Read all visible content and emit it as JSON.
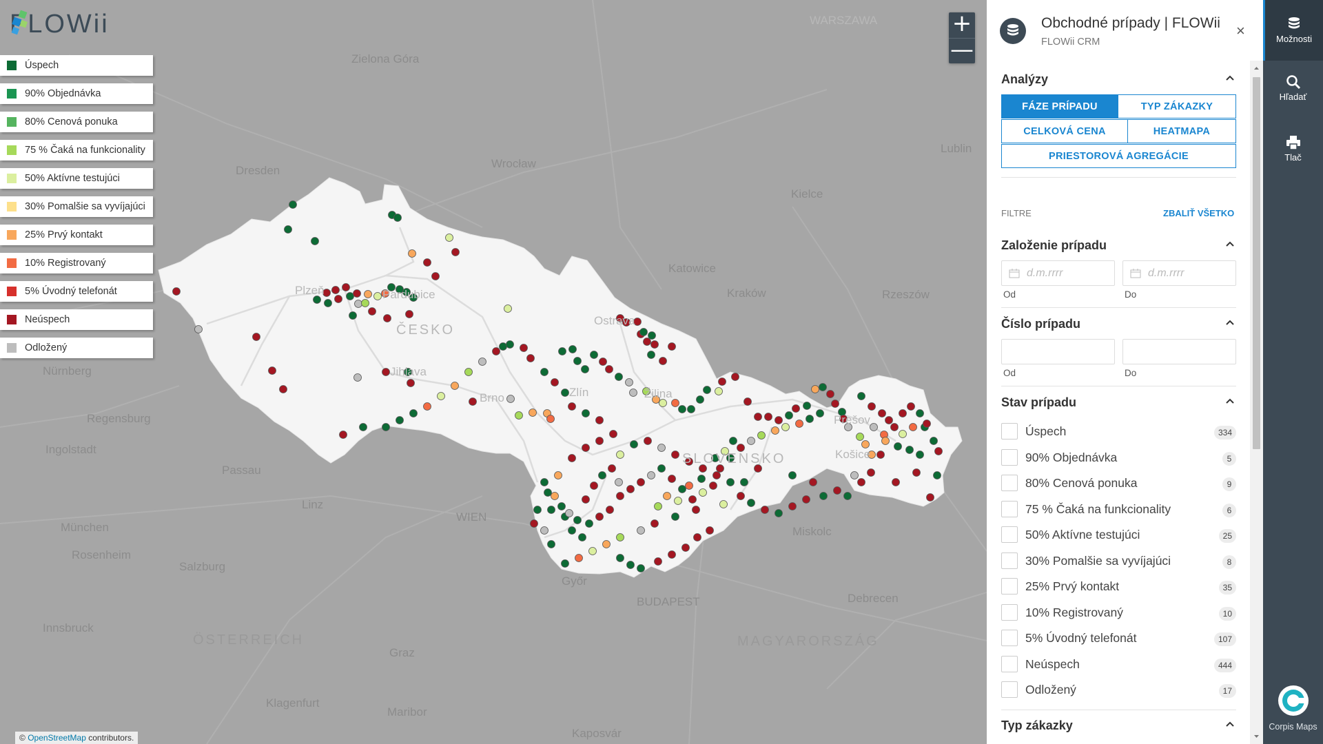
{
  "app": {
    "logo_text": "FLOWii"
  },
  "map": {
    "attribution_prefix": "©",
    "attribution_link": "OpenStreetMap",
    "attribution_suffix": "contributors.",
    "zoom_in": "+",
    "zoom_out": "—",
    "labels": [
      "Zielona Góra",
      "Dresden",
      "Wrocław",
      "Kielce",
      "Katowice",
      "Kraków",
      "Rzeszów",
      "Lublin",
      "WARSZAWA",
      "Plzeň",
      "Pardubice",
      "ČESKO",
      "Jihlava",
      "Brno",
      "Ostrava",
      "Žilina",
      "Zlín",
      "SLOVENSKO",
      "Prešov",
      "Košice",
      "Regensburg",
      "Ingolstadt",
      "Passau",
      "München",
      "Rosenheim",
      "Salzburg",
      "Linz",
      "WIEN",
      "Nürnberg",
      "Innsbruck",
      "ÖSTERREICH",
      "Graz",
      "Klagenfurt",
      "Maribor",
      "Győr",
      "BUDAPEST",
      "MAGYARORSZÁG",
      "Miskolc",
      "Debrecen",
      "Kaposvár"
    ]
  },
  "legend": [
    {
      "label": "Úspech",
      "color": "#0d6b35"
    },
    {
      "label": "90% Objednávka",
      "color": "#1b9552"
    },
    {
      "label": "80% Cenová ponuka",
      "color": "#55b45f"
    },
    {
      "label": "75 % Čaká na funkcionality",
      "color": "#a6d95a"
    },
    {
      "label": "50% Aktívne testujúci",
      "color": "#dbef9f"
    },
    {
      "label": "30% Pomalšie sa vyvíjajúci",
      "color": "#fde08b"
    },
    {
      "label": "25% Prvý kontakt",
      "color": "#f8a75c"
    },
    {
      "label": "10% Registrovaný",
      "color": "#f26b43"
    },
    {
      "label": "5% Úvodný telefonát",
      "color": "#d6302c"
    },
    {
      "label": "Neúspech",
      "color": "#a41722"
    },
    {
      "label": "Odložený",
      "color": "#bdbdbd"
    }
  ],
  "panel": {
    "title": "Obchodné prípady | FLOWii",
    "subtitle": "FLOWii CRM",
    "close": "×",
    "analyses": {
      "heading": "Analýzy",
      "tabs": [
        "FÁZE PRÍPADU",
        "TYP ZÁKAZKY",
        "CELKOVÁ CENA",
        "HEATMAPA",
        "PRIESTOROVÁ AGREGÁCIE"
      ],
      "active": "FÁZE PRÍPADU"
    },
    "filters_label": "FILTRE",
    "collapse_all": "ZBALIŤ VŠETKO",
    "zalozenie": {
      "heading": "Založenie prípadu",
      "from_placeholder": "d.m.rrrr",
      "to_placeholder": "d.m.rrrr",
      "from_label": "Od",
      "to_label": "Do"
    },
    "cislo": {
      "heading": "Číslo prípadu",
      "from_label": "Od",
      "to_label": "Do"
    },
    "stav": {
      "heading": "Stav prípadu",
      "items": [
        {
          "label": "Úspech",
          "count": "334"
        },
        {
          "label": "90% Objednávka",
          "count": "5"
        },
        {
          "label": "80% Cenová ponuka",
          "count": "9"
        },
        {
          "label": "75 % Čaká na funkcionality",
          "count": "6"
        },
        {
          "label": "50% Aktívne testujúci",
          "count": "25"
        },
        {
          "label": "30% Pomalšie sa vyvíjajúci",
          "count": "8"
        },
        {
          "label": "25% Prvý kontakt",
          "count": "35"
        },
        {
          "label": "10% Registrovaný",
          "count": "10"
        },
        {
          "label": "5% Úvodný telefonát",
          "count": "107"
        },
        {
          "label": "Neúspech",
          "count": "444"
        },
        {
          "label": "Odložený",
          "count": "17"
        }
      ]
    },
    "typ": {
      "heading": "Typ zákazky"
    }
  },
  "rail": {
    "moznosti": "Možnosti",
    "hladat": "Hľadať",
    "tlac": "Tlač",
    "corpis": "Corpis Maps"
  },
  "colors": {
    "accent": "#1a86d0",
    "rail": "#3d4a55"
  }
}
